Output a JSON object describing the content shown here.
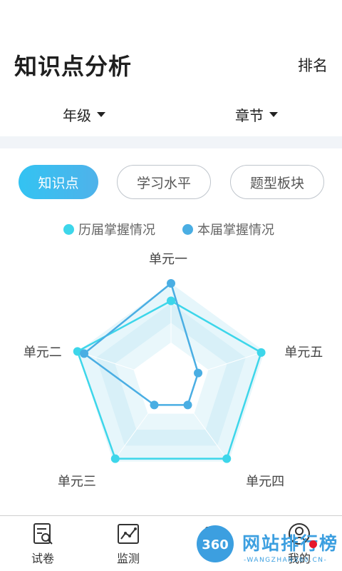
{
  "header": {
    "title": "知识点分析",
    "rank_label": "排名"
  },
  "filters": {
    "grade_label": "年级",
    "chapter_label": "章节"
  },
  "tabs": [
    {
      "label": "知识点",
      "active": true
    },
    {
      "label": "学习水平",
      "active": false
    },
    {
      "label": "题型板块",
      "active": false
    }
  ],
  "legend": [
    {
      "label": "历届掌握情况",
      "color": "#3dd6ea"
    },
    {
      "label": "本届掌握情况",
      "color": "#4aaee3"
    }
  ],
  "chart_data": {
    "type": "radar",
    "axes": [
      "单元一",
      "单元五",
      "单元四",
      "单元三",
      "单元二"
    ],
    "max": 100,
    "series": [
      {
        "name": "历届掌握情况",
        "color": "#3dd6ea",
        "values": [
          75,
          95,
          95,
          95,
          100
        ]
      },
      {
        "name": "本届掌握情况",
        "color": "#4aaee3",
        "values": [
          100,
          0,
          0,
          0,
          90
        ]
      }
    ]
  },
  "bottom_nav": [
    {
      "label": "试卷",
      "icon": "paper-search-icon"
    },
    {
      "label": "监测",
      "icon": "chart-image-icon"
    },
    {
      "label": "",
      "icon": "analysis-icon"
    },
    {
      "label": "我的",
      "icon": "user-icon"
    }
  ],
  "watermark": {
    "badge": "360",
    "text": "网站排行榜",
    "sub": "-WANGZHAN360.CN-"
  }
}
